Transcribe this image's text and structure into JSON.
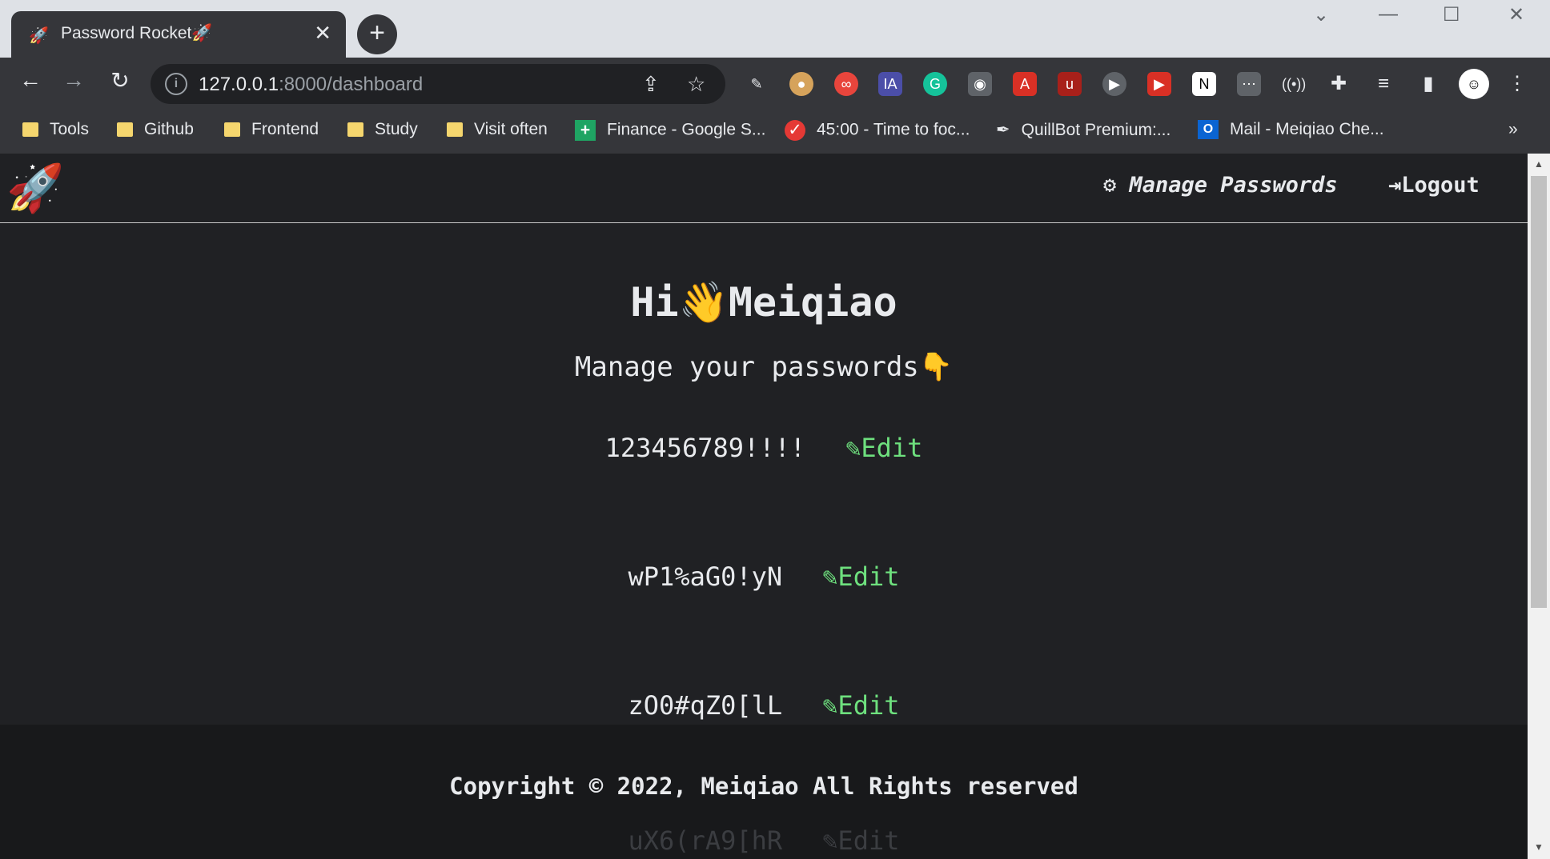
{
  "browser": {
    "tab_title": "Password Rocket🚀",
    "tab_favicon": "🚀",
    "url_host": "127.0.0.1",
    "url_rest": ":8000/dashboard",
    "bookmarks": [
      "Tools",
      "Github",
      "Frontend",
      "Study",
      "Visit often",
      "Finance - Google S...",
      "45:00 - Time to foc...",
      "QuillBot Premium:...",
      "Mail - Meiqiao Che..."
    ]
  },
  "site": {
    "logo": "🚀",
    "nav_manage": "Manage Passwords",
    "nav_logout": "Logout"
  },
  "main": {
    "greeting": "Hi👋Meiqiao",
    "subtitle": "Manage your passwords👇",
    "passwords": [
      {
        "value": "123456789!!!!",
        "edit": "Edit"
      },
      {
        "value": "wP1%aG0!yN",
        "edit": "Edit"
      },
      {
        "value": "zO0#qZ0[lL",
        "edit": "Edit"
      },
      {
        "value": "uX6(rA9[hR",
        "edit": "Edit"
      }
    ]
  },
  "footer": {
    "copyright": "Copyright © 2022, Meiqiao All Rights reserved"
  }
}
